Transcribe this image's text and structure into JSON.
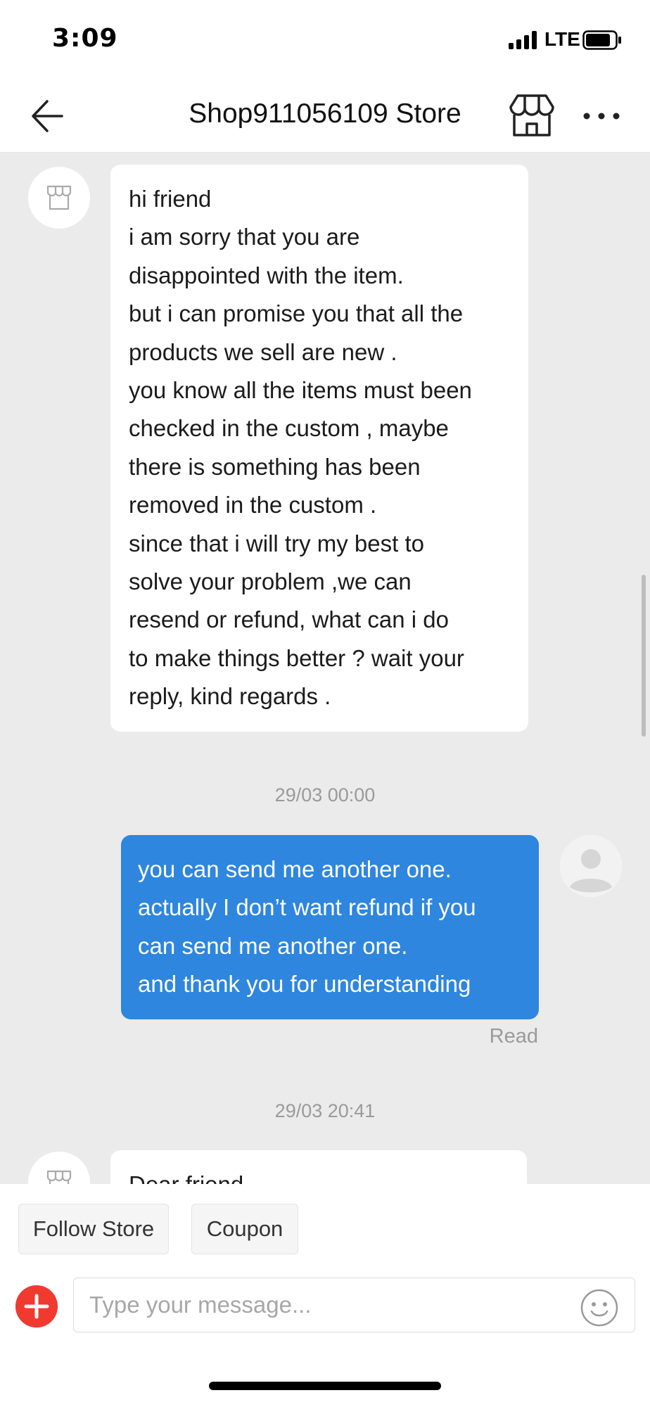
{
  "status_bar": {
    "time": "3:09",
    "network": "LTE"
  },
  "header": {
    "title": "Shop911056109 Store"
  },
  "messages": [
    {
      "lines": [
        "hi friend",
        "i am sorry that you are",
        "disappointed with the item.",
        "but i can promise you that all the",
        "products we sell are new .",
        "you know all the items must been",
        "checked in the custom , maybe",
        "there is something has been",
        "removed in the custom .",
        "since that i will try my best to",
        "solve your problem ,we can",
        "resend or refund, what can i do",
        "to make things better ? wait your",
        "reply, kind regards ."
      ]
    },
    {
      "timestamp": "29/03 00:00",
      "lines": [
        "you can send me another one.",
        "actually I don’t want refund if you",
        "can send me another one.",
        "and thank you for understanding"
      ],
      "status": "Read"
    },
    {
      "timestamp": "29/03 20:41",
      "lines": [
        "Dear friend"
      ]
    }
  ],
  "quick_actions": {
    "follow_label": "Follow Store",
    "coupon_label": "Coupon"
  },
  "composer": {
    "placeholder": "Type your message..."
  },
  "colors": {
    "outgoing_bubble": "#2e86de",
    "add_button": "#f03a2f",
    "chat_background": "#ebebeb"
  },
  "icons": [
    "back-arrow-icon",
    "store-icon",
    "more-icon",
    "store-avatar-icon",
    "user-avatar-icon",
    "plus-icon",
    "emoji-icon"
  ]
}
